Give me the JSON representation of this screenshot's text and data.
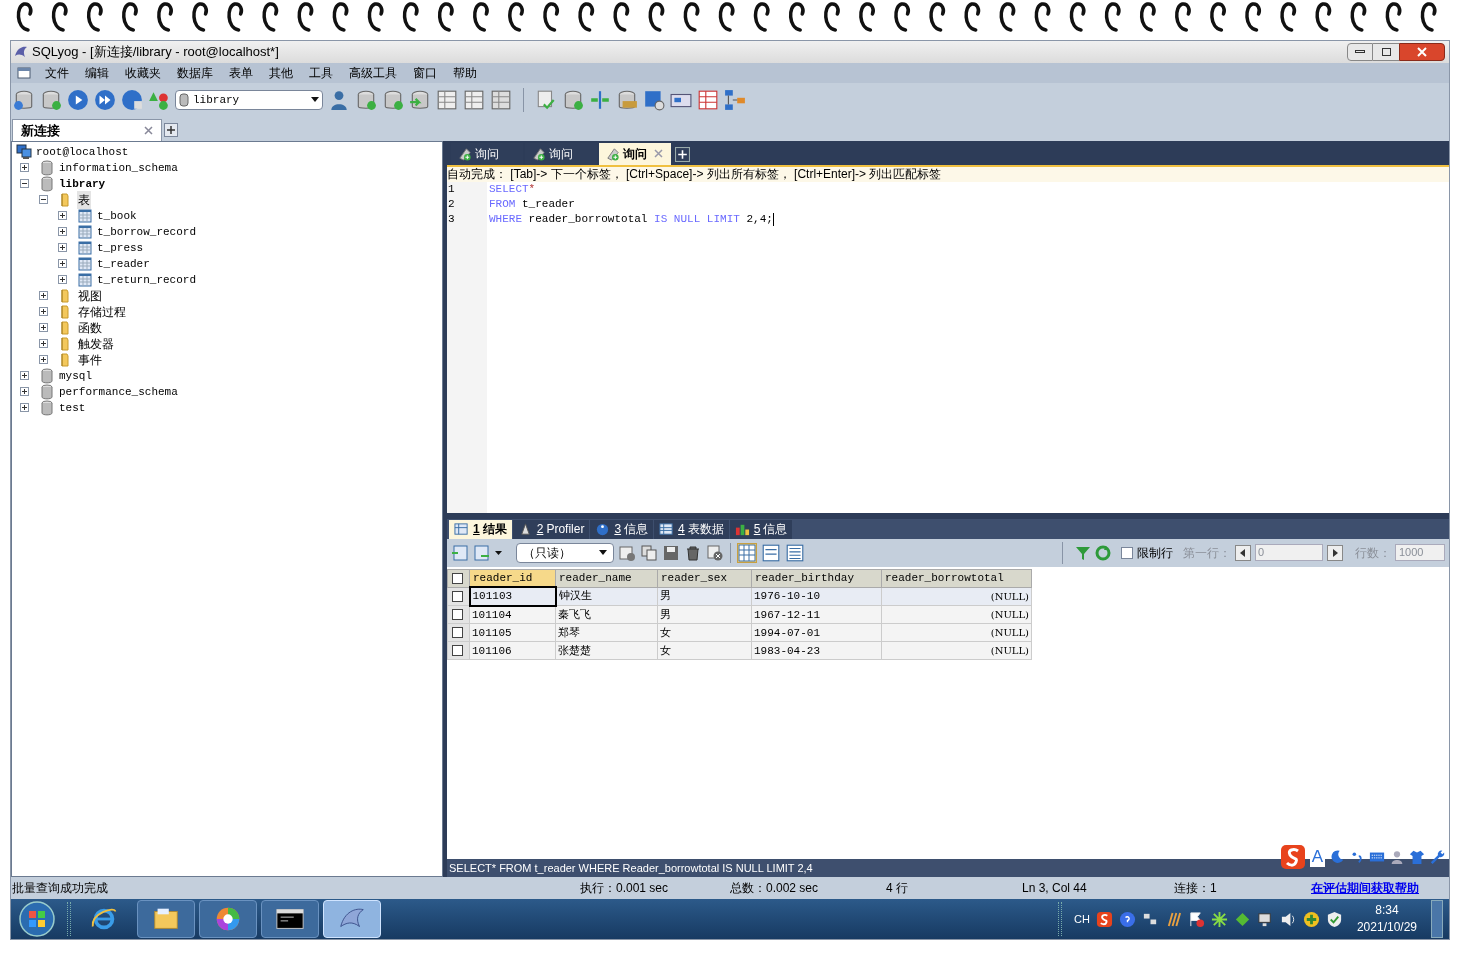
{
  "window": {
    "title": "SQLyog - [新连接/library - root@localhost*]"
  },
  "menu": [
    "文件",
    "编辑",
    "收藏夹",
    "数据库",
    "表单",
    "其他",
    "工具",
    "高级工具",
    "窗口",
    "帮助"
  ],
  "toolbar": {
    "database_selector": "library"
  },
  "connection_tabs": [
    {
      "label": "新连接",
      "selected": true
    }
  ],
  "tree": {
    "label": "root@localhost",
    "kind": "server",
    "children": [
      {
        "label": "information_schema",
        "kind": "database",
        "expanded": false,
        "current": false,
        "selected": false
      },
      {
        "label": "library",
        "kind": "database",
        "expanded": true,
        "current": true,
        "selected": false,
        "children": [
          {
            "label": "表",
            "kind": "folder",
            "expanded": true,
            "selected": true,
            "children": [
              {
                "label": "t_book",
                "kind": "table",
                "expanded": false,
                "selected": false
              },
              {
                "label": "t_borrow_record",
                "kind": "table",
                "expanded": false,
                "selected": false
              },
              {
                "label": "t_press",
                "kind": "table",
                "expanded": false,
                "selected": false
              },
              {
                "label": "t_reader",
                "kind": "table",
                "expanded": false,
                "selected": false
              },
              {
                "label": "t_return_record",
                "kind": "table",
                "expanded": false,
                "selected": false
              }
            ]
          },
          {
            "label": "视图",
            "kind": "folder",
            "expanded": false,
            "selected": false
          },
          {
            "label": "存储过程",
            "kind": "folder",
            "expanded": false,
            "selected": false
          },
          {
            "label": "函数",
            "kind": "folder",
            "expanded": false,
            "selected": false
          },
          {
            "label": "触发器",
            "kind": "folder",
            "expanded": false,
            "selected": false
          },
          {
            "label": "事件",
            "kind": "folder",
            "expanded": false,
            "selected": false
          }
        ]
      },
      {
        "label": "mysql",
        "kind": "database",
        "expanded": false,
        "current": false,
        "selected": false
      },
      {
        "label": "performance_schema",
        "kind": "database",
        "expanded": false,
        "current": false,
        "selected": false
      },
      {
        "label": "test",
        "kind": "database",
        "expanded": false,
        "current": false,
        "selected": false
      }
    ]
  },
  "query_tabs": [
    {
      "label": "询问",
      "selected": false
    },
    {
      "label": "询问",
      "selected": false
    },
    {
      "label": "询问",
      "selected": true
    }
  ],
  "editor": {
    "hint": "自动完成：  [Tab]-> 下一个标签，  [Ctrl+Space]-> 列出所有标签，  [Ctrl+Enter]-> 列出匹配标签",
    "lines": [
      {
        "number": "1",
        "tokens": [
          {
            "kind": "keyword",
            "text": "SELECT"
          },
          {
            "kind": "operator",
            "text": "*"
          }
        ]
      },
      {
        "number": "2",
        "tokens": [
          {
            "kind": "keyword",
            "text": "FROM"
          },
          {
            "kind": "plain",
            "text": " t_reader"
          }
        ]
      },
      {
        "number": "3",
        "tokens": [
          {
            "kind": "keyword",
            "text": "WHERE"
          },
          {
            "kind": "plain",
            "text": " reader_borrowtotal "
          },
          {
            "kind": "keyword",
            "text": "IS NULL LIMIT"
          },
          {
            "kind": "plain",
            "text": " 2,4;"
          }
        ]
      }
    ]
  },
  "result_tabs": [
    {
      "number": "1",
      "label": "结果",
      "selected": true
    },
    {
      "number": "2",
      "label": "Profiler",
      "selected": false
    },
    {
      "number": "3",
      "label": "信息",
      "selected": false
    },
    {
      "number": "4",
      "label": "表数据",
      "selected": false
    },
    {
      "number": "5",
      "label": "信息",
      "selected": false
    }
  ],
  "result_toolbar": {
    "mode": "（只读）",
    "limit_rows": {
      "label": "限制行",
      "checked": false
    },
    "first_row_label": "第一行：",
    "first_row": "0",
    "rows_label": "行数：",
    "rows": "1000",
    "disabled": true
  },
  "grid": {
    "all_checked": false,
    "columns": [
      {
        "name": "reader_id",
        "active": true
      },
      {
        "name": "reader_name",
        "active": false
      },
      {
        "name": "reader_sex",
        "active": false
      },
      {
        "name": "reader_birthday",
        "active": false
      },
      {
        "name": "reader_borrowtotal",
        "active": false
      }
    ],
    "rows": [
      {
        "checked": false,
        "selected": true,
        "cells": [
          "101103",
          "钟汉生",
          "男",
          "1976-10-10",
          "(NULL)"
        ]
      },
      {
        "checked": false,
        "selected": false,
        "cells": [
          "101104",
          "秦飞飞",
          "男",
          "1967-12-11",
          "(NULL)"
        ]
      },
      {
        "checked": false,
        "selected": false,
        "cells": [
          "101105",
          "郑琴",
          "女",
          "1994-07-01",
          "(NULL)"
        ]
      },
      {
        "checked": false,
        "selected": false,
        "cells": [
          "101106",
          "张楚楚",
          "女",
          "1983-04-23",
          "(NULL)"
        ]
      }
    ]
  },
  "query_bar": "SELECT* FROM t_reader WHERE Reader_borrowtotal IS NULL LIMIT 2,4",
  "ime_letter": "A",
  "status_bar": {
    "message": "批量查询成功完成",
    "execution": "执行：0.001 sec",
    "total": "总数：0.002 sec",
    "rows": "4 行",
    "position": "Ln 3, Col 44",
    "connection": "连接：1",
    "link": "在评估期间获取帮助"
  },
  "taskbar": {
    "apps": [
      {
        "kind": "browser",
        "active": false
      },
      {
        "kind": "folder",
        "active": false
      },
      {
        "kind": "wheel",
        "active": false
      },
      {
        "kind": "console",
        "active": false
      },
      {
        "kind": "dolphin",
        "active": true
      }
    ],
    "language": "CH",
    "time": "8:34",
    "date": "2021/10/29"
  }
}
